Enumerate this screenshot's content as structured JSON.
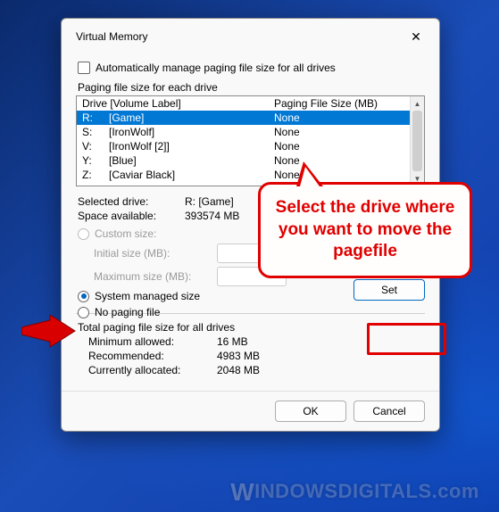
{
  "dialog": {
    "title": "Virtual Memory",
    "auto_manage_label": "Automatically manage paging file size for all drives",
    "group_label": "Paging file size for each drive",
    "header_drive": "Drive  [Volume Label]",
    "header_size": "Paging File Size (MB)",
    "drives": [
      {
        "letter": "R:",
        "label": "[Game]",
        "size": "None",
        "selected": true
      },
      {
        "letter": "S:",
        "label": "[IronWolf]",
        "size": "None"
      },
      {
        "letter": "V:",
        "label": "[IronWolf [2]]",
        "size": "None"
      },
      {
        "letter": "Y:",
        "label": "[Blue]",
        "size": "None"
      },
      {
        "letter": "Z:",
        "label": "[Caviar Black]",
        "size": "None"
      }
    ],
    "selected_drive_label": "Selected drive:",
    "selected_drive_value": "R:  [Game]",
    "space_label": "Space available:",
    "space_value": "393574 MB",
    "custom_size_label": "Custom size:",
    "initial_size_label": "Initial size (MB):",
    "max_size_label": "Maximum size (MB):",
    "system_managed_label": "System managed size",
    "no_paging_label": "No paging file",
    "set_label": "Set",
    "totals_label": "Total paging file size for all drives",
    "min_label": "Minimum allowed:",
    "min_value": "16 MB",
    "rec_label": "Recommended:",
    "rec_value": "4983 MB",
    "cur_label": "Currently allocated:",
    "cur_value": "2048 MB",
    "ok_label": "OK",
    "cancel_label": "Cancel"
  },
  "callout": "Select the drive where you want to move the pagefile",
  "watermark": "INDOWSDIGITALS",
  "watermark_suffix": ".com"
}
